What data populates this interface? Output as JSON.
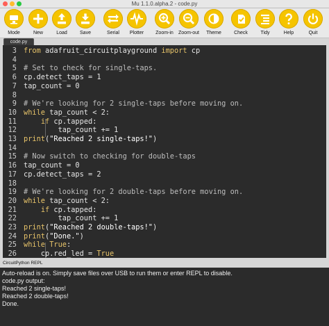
{
  "window": {
    "title": "Mu 1.1.0.alpha.2 - code.py"
  },
  "toolbar": {
    "buttons": [
      {
        "label": "Mode",
        "icon": "mode-icon"
      },
      {
        "label": "New",
        "icon": "plus-icon"
      },
      {
        "label": "Load",
        "icon": "upload-icon"
      },
      {
        "label": "Save",
        "icon": "download-icon"
      },
      {
        "label": "Serial",
        "icon": "serial-icon"
      },
      {
        "label": "Plotter",
        "icon": "plotter-icon"
      },
      {
        "label": "Zoom-in",
        "icon": "zoom-in-icon"
      },
      {
        "label": "Zoom-out",
        "icon": "zoom-out-icon"
      },
      {
        "label": "Theme",
        "icon": "theme-icon"
      },
      {
        "label": "Check",
        "icon": "check-icon"
      },
      {
        "label": "Tidy",
        "icon": "tidy-icon"
      },
      {
        "label": "Help",
        "icon": "help-icon"
      },
      {
        "label": "Quit",
        "icon": "quit-icon"
      }
    ],
    "accent": "#f5c400"
  },
  "tabs": [
    {
      "label": "code.py"
    }
  ],
  "editor": {
    "lines": [
      {
        "n": "3",
        "text": "from adafruit_circuitplayground import cp"
      },
      {
        "n": "4",
        "text": ""
      },
      {
        "n": "5",
        "text": "# Set to check for single-taps."
      },
      {
        "n": "6",
        "text": "cp.detect_taps = 1"
      },
      {
        "n": "7",
        "text": "tap_count = 0"
      },
      {
        "n": "8",
        "text": ""
      },
      {
        "n": "9",
        "text": "# We're looking for 2 single-taps before moving on."
      },
      {
        "n": "10",
        "text": "while tap_count < 2:"
      },
      {
        "n": "11",
        "text": "    if cp.tapped:"
      },
      {
        "n": "12",
        "text": "        tap_count += 1"
      },
      {
        "n": "13",
        "text": "print(\"Reached 2 single-taps!\")"
      },
      {
        "n": "14",
        "text": ""
      },
      {
        "n": "15",
        "text": "# Now switch to checking for double-taps"
      },
      {
        "n": "16",
        "text": "tap_count = 0"
      },
      {
        "n": "17",
        "text": "cp.detect_taps = 2"
      },
      {
        "n": "18",
        "text": ""
      },
      {
        "n": "19",
        "text": "# We're looking for 2 double-taps before moving on."
      },
      {
        "n": "20",
        "text": "while tap_count < 2:"
      },
      {
        "n": "21",
        "text": "    if cp.tapped:"
      },
      {
        "n": "22",
        "text": "        tap_count += 1"
      },
      {
        "n": "23",
        "text": "print(\"Reached 2 double-taps!\")"
      },
      {
        "n": "24",
        "text": "print(\"Done.\")"
      },
      {
        "n": "25",
        "text": "while True:"
      },
      {
        "n": "26",
        "text": "    cp.red_led = True"
      }
    ],
    "background": "#2b2b2b"
  },
  "repl": {
    "label": "CircuitPython REPL",
    "lines": [
      "Auto-reload is on. Simply save files over USB to run them or enter REPL to disable.",
      "code.py output:",
      "Reached 2 single-taps!",
      "Reached 2 double-taps!",
      "Done."
    ]
  }
}
